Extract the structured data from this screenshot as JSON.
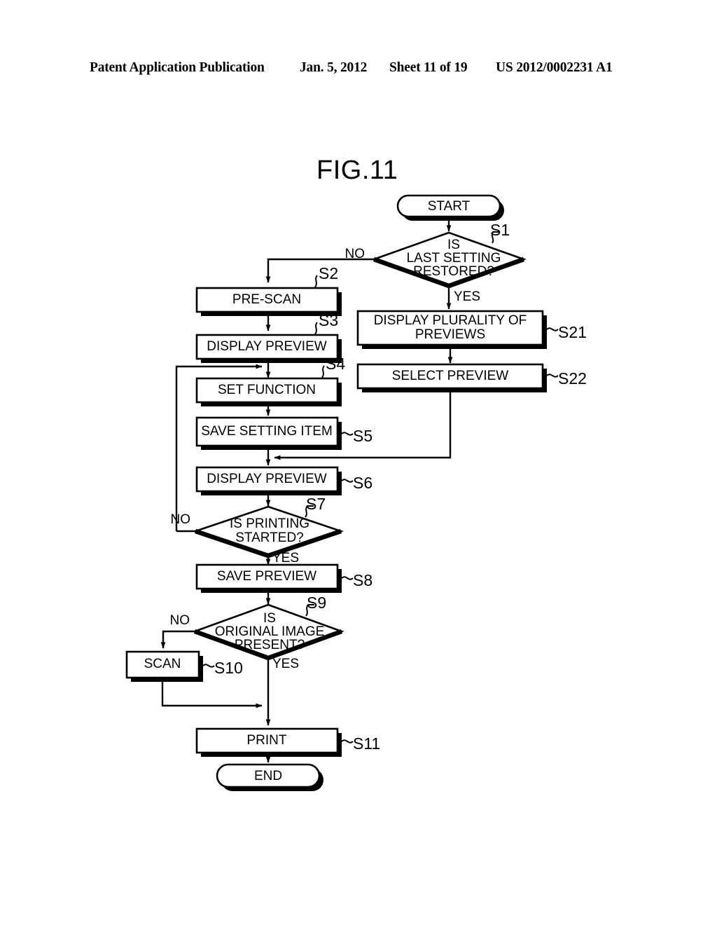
{
  "header": {
    "publication": "Patent Application Publication",
    "date": "Jan. 5, 2012",
    "sheet": "Sheet 11 of 19",
    "number": "US 2012/0002231 A1"
  },
  "figure": {
    "title": "FIG.11",
    "type": "flowchart"
  },
  "flowchart": {
    "nodes": [
      {
        "id": "start",
        "shape": "terminator",
        "label": "START",
        "step": ""
      },
      {
        "id": "s1",
        "shape": "decision",
        "label_line1": "IS",
        "label_line2": "LAST SETTING",
        "label_line3": "RESTORED?",
        "step": "S1"
      },
      {
        "id": "s2",
        "shape": "process",
        "label": "PRE-SCAN",
        "step": "S2"
      },
      {
        "id": "s3",
        "shape": "process",
        "label": "DISPLAY PREVIEW",
        "step": "S3"
      },
      {
        "id": "s4",
        "shape": "process",
        "label": "SET FUNCTION",
        "step": "S4"
      },
      {
        "id": "s5",
        "shape": "process",
        "label": "SAVE SETTING ITEM",
        "step": "S5"
      },
      {
        "id": "s6",
        "shape": "process",
        "label": "DISPLAY PREVIEW",
        "step": "S6"
      },
      {
        "id": "s7",
        "shape": "decision",
        "label_line1": "IS PRINTING",
        "label_line2": "STARTED?",
        "step": "S7"
      },
      {
        "id": "s8",
        "shape": "process",
        "label": "SAVE PREVIEW",
        "step": "S8"
      },
      {
        "id": "s9",
        "shape": "decision",
        "label_line1": "IS",
        "label_line2": "ORIGINAL IMAGE",
        "label_line3": "PRESENT?",
        "step": "S9"
      },
      {
        "id": "s10",
        "shape": "process",
        "label": "SCAN",
        "step": "S10"
      },
      {
        "id": "s11",
        "shape": "process",
        "label": "PRINT",
        "step": "S11"
      },
      {
        "id": "s21",
        "shape": "process",
        "label_line1": "DISPLAY PLURALITY OF",
        "label_line2": "PREVIEWS",
        "step": "S21"
      },
      {
        "id": "s22",
        "shape": "process",
        "label": "SELECT PREVIEW",
        "step": "S22"
      },
      {
        "id": "end",
        "shape": "terminator",
        "label": "END",
        "step": ""
      }
    ],
    "branch_labels": {
      "s1_no": "NO",
      "s1_yes": "YES",
      "s7_no": "NO",
      "s7_yes": "YES",
      "s9_no": "NO",
      "s9_yes": "YES"
    },
    "steps": {
      "s1": "S1",
      "s2": "S2",
      "s3": "S3",
      "s4": "S4",
      "s5": "S5",
      "s6": "S6",
      "s7": "S7",
      "s8": "S8",
      "s9": "S9",
      "s10": "S10",
      "s11": "S11",
      "s21": "S21",
      "s22": "S22"
    },
    "colors": {
      "ink": "#000000",
      "paper": "#ffffff"
    }
  }
}
